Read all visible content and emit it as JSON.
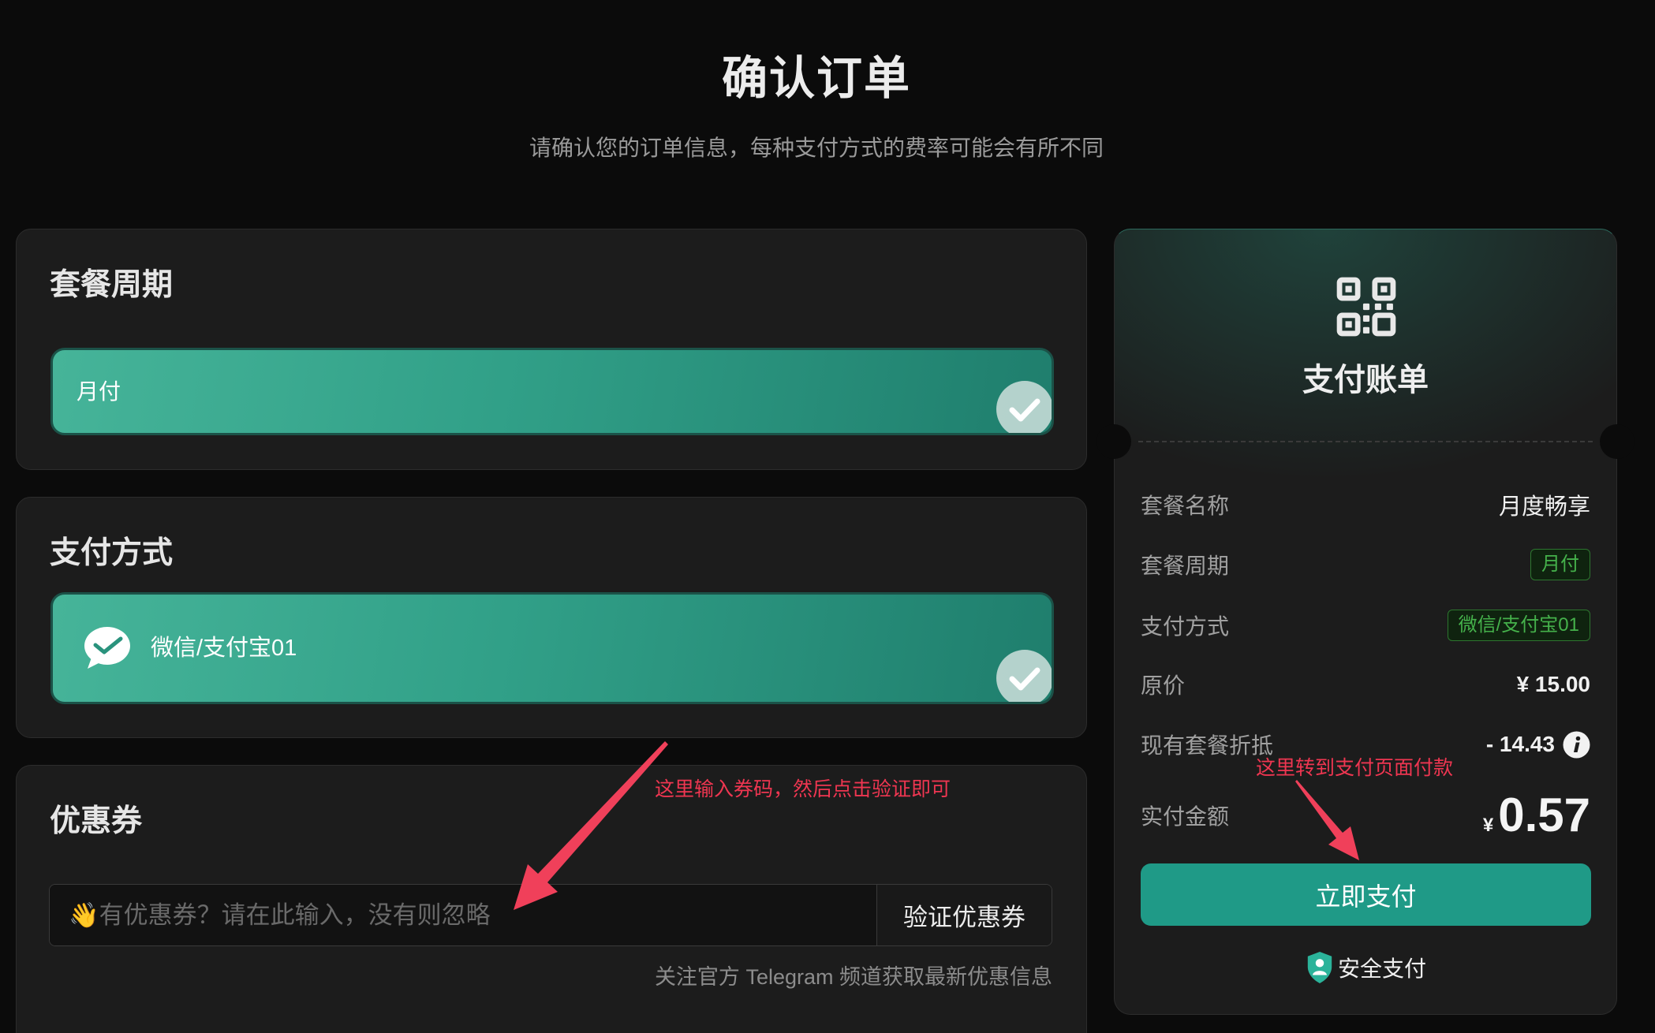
{
  "colors": {
    "page_bg": "#0b0b0b",
    "card_bg": "#1c1c1c",
    "accent": "#1f9a87",
    "selected_option_start": "#46b499",
    "selected_option_end": "#1f7e6d",
    "badge_green": "#45b14b",
    "annotation_red": "#ef3651"
  },
  "header": {
    "title": "确认订单",
    "subtitle": "请确认您的订单信息，每种支付方式的费率可能会有所不同"
  },
  "period": {
    "heading": "套餐周期",
    "options": [
      {
        "label": "月付",
        "selected": true,
        "check_icon": "check-circle-icon"
      }
    ]
  },
  "payment": {
    "heading": "支付方式",
    "options": [
      {
        "label": "微信/支付宝01",
        "icon": "wechat-pay-icon",
        "selected": true,
        "check_icon": "check-circle-icon"
      }
    ]
  },
  "coupon": {
    "heading": "优惠券",
    "placeholder": "👋有优惠券？请在此输入，没有则忽略",
    "value": "",
    "verify_label": "验证优惠券",
    "note": "关注官方 Telegram 频道获取最新优惠信息"
  },
  "bill": {
    "icon": "qr-code-icon",
    "title": "支付账单",
    "rows": [
      {
        "label": "套餐名称",
        "value": "月度畅享"
      },
      {
        "label": "套餐周期",
        "value": "月付",
        "style": "badge"
      },
      {
        "label": "支付方式",
        "value": "微信/支付宝01",
        "style": "badge"
      },
      {
        "label": "原价",
        "value": "¥ 15.00"
      },
      {
        "label": "现有套餐折抵",
        "value": "- 14.43",
        "icon": "info-icon"
      }
    ],
    "total": {
      "label": "实付金额",
      "currency": "¥",
      "amount": "0.57"
    },
    "pay_label": "立即支付",
    "secure_icon": "shield-icon",
    "secure_label": "安全支付"
  },
  "annotations": [
    {
      "text": "这里输入券码，然后点击验证即可",
      "icon": "arrow-icon"
    },
    {
      "text": "这里转到支付页面付款",
      "icon": "arrow-icon"
    }
  ]
}
